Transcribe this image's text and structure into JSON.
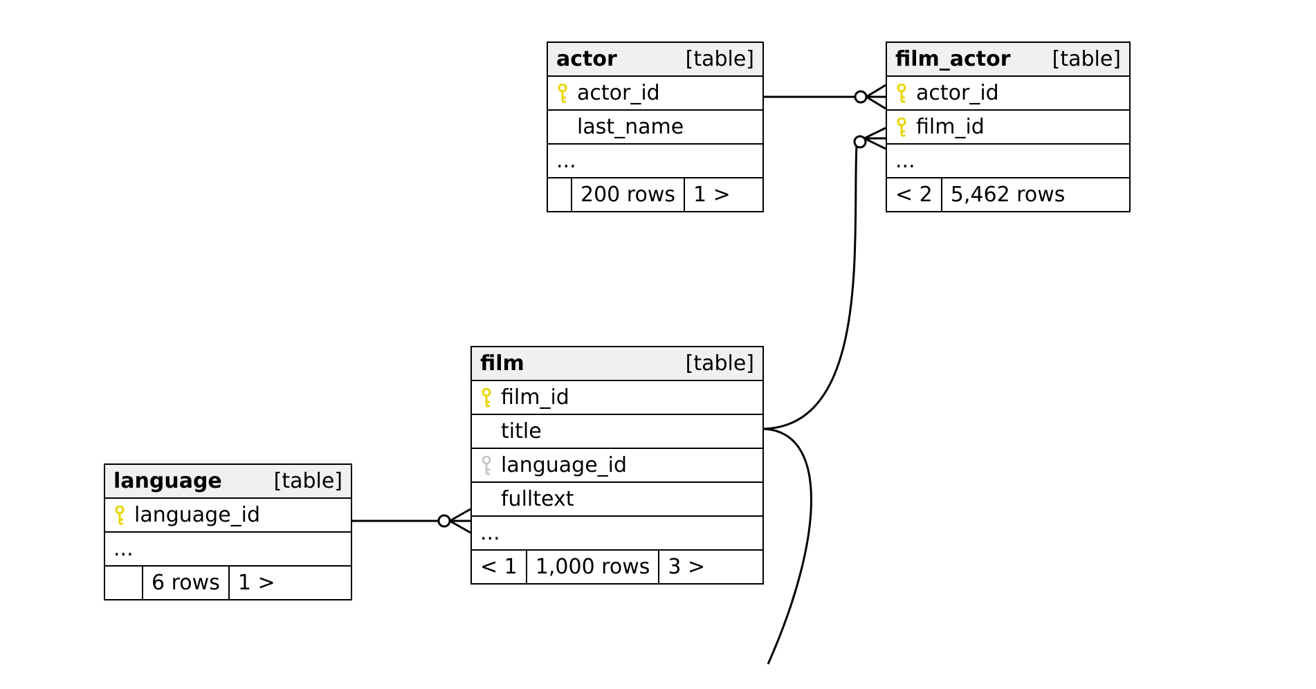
{
  "tag_label": "[table]",
  "ellipsis": "...",
  "tables": {
    "actor": {
      "name": "actor",
      "cols": [
        {
          "name": "actor_id",
          "pk": true
        },
        {
          "name": "last_name",
          "pk": false
        }
      ],
      "footer": {
        "in": "",
        "rows": "200 rows",
        "out": "1 >"
      }
    },
    "film_actor": {
      "name": "film_actor",
      "cols": [
        {
          "name": "actor_id",
          "pk": true
        },
        {
          "name": "film_id",
          "pk": true
        }
      ],
      "footer": {
        "in": "< 2",
        "rows": "5,462 rows",
        "out": ""
      }
    },
    "film": {
      "name": "film",
      "cols": [
        {
          "name": "film_id",
          "pk": true
        },
        {
          "name": "title",
          "pk": false
        },
        {
          "name": "language_id",
          "pk": false,
          "fk": true
        },
        {
          "name": "fulltext",
          "pk": false
        }
      ],
      "footer": {
        "in": "< 1",
        "rows": "1,000 rows",
        "out": "3 >"
      }
    },
    "language": {
      "name": "language",
      "cols": [
        {
          "name": "language_id",
          "pk": true
        }
      ],
      "footer": {
        "in": "",
        "rows": "6 rows",
        "out": "1 >"
      }
    }
  },
  "relationships": [
    {
      "from": "actor.actor_id",
      "to": "film_actor.actor_id"
    },
    {
      "from": "film.film_id",
      "to": "film_actor.film_id"
    },
    {
      "from": "language.language_id",
      "to": "film.language_id"
    }
  ]
}
